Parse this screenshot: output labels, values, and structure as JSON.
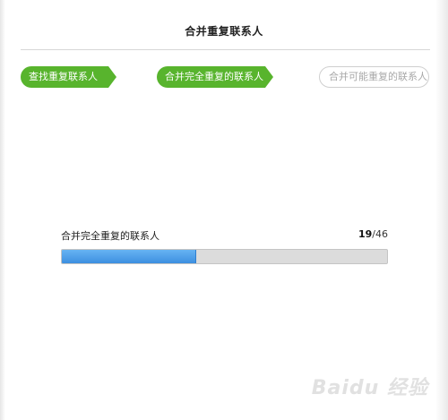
{
  "dialog": {
    "title": "合并重复联系人"
  },
  "steps": [
    {
      "label": "查找重复联系人",
      "state": "done"
    },
    {
      "label": "合并完全重复的联系人",
      "state": "current"
    },
    {
      "label": "合并可能重复的联系人",
      "state": "pending"
    }
  ],
  "progress": {
    "label": "合并完全重复的联系人",
    "current": "19",
    "total": "/46",
    "fraction": 0.413
  },
  "watermark": {
    "text": "Baidu 经验"
  },
  "colors": {
    "accent_green": "#58b42d",
    "progress_blue": "#3d8fe0",
    "track_gray": "#dcdcdc"
  }
}
